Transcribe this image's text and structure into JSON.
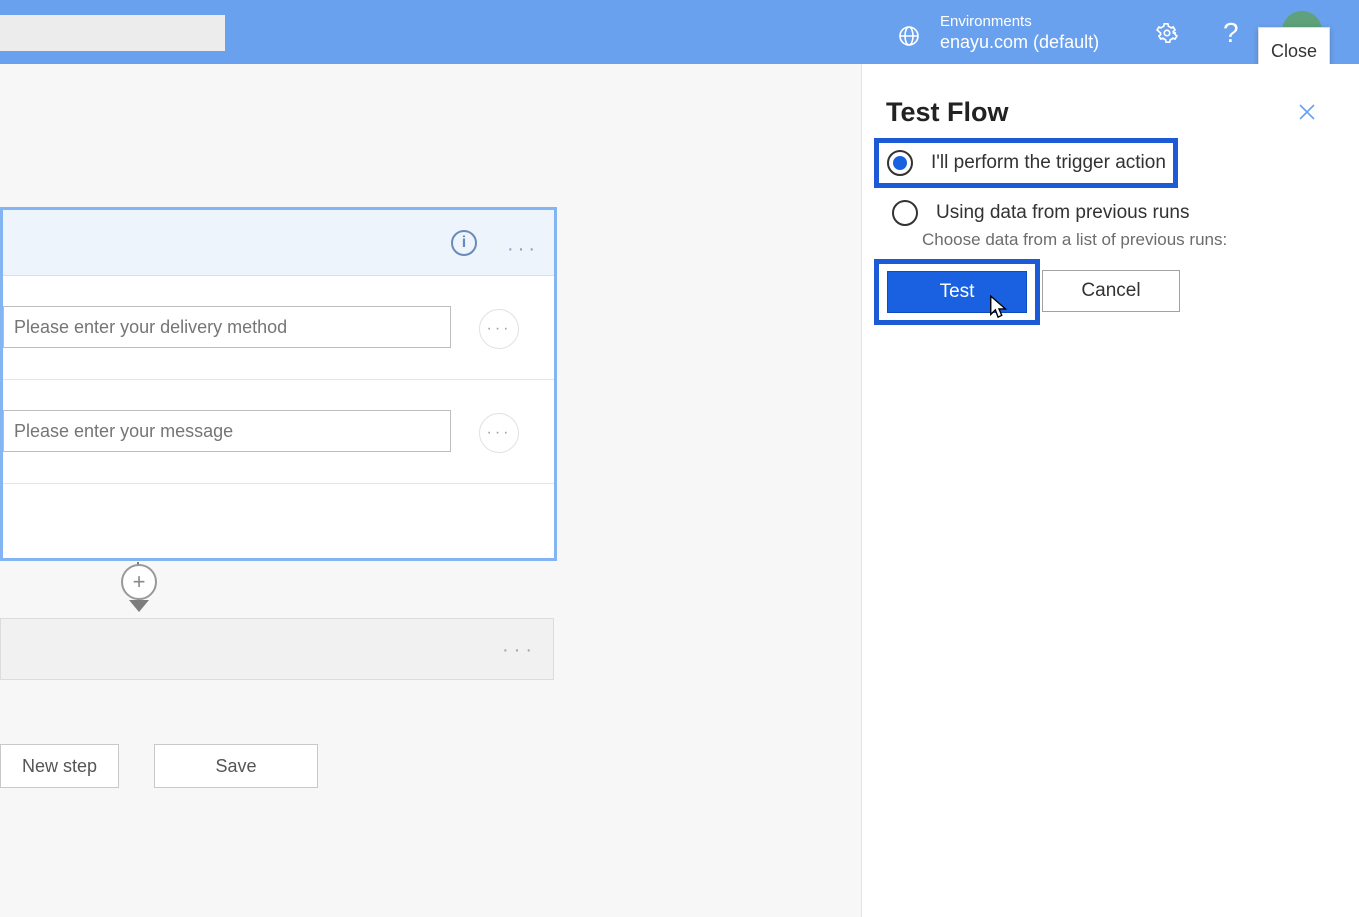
{
  "topbar": {
    "env_label": "Environments",
    "env_name": "enayu.com (default)",
    "close_tooltip": "Close"
  },
  "card": {
    "field1_placeholder": "Please enter your delivery method",
    "field2_placeholder": "Please enter your message"
  },
  "footer": {
    "new_step": "New step",
    "save": "Save"
  },
  "panel": {
    "title": "Test Flow",
    "option1_label": "I'll perform the trigger action",
    "option2_label": "Using data from previous runs",
    "option2_sub": "Choose data from a list of previous runs:",
    "test_label": "Test",
    "cancel_label": "Cancel"
  }
}
